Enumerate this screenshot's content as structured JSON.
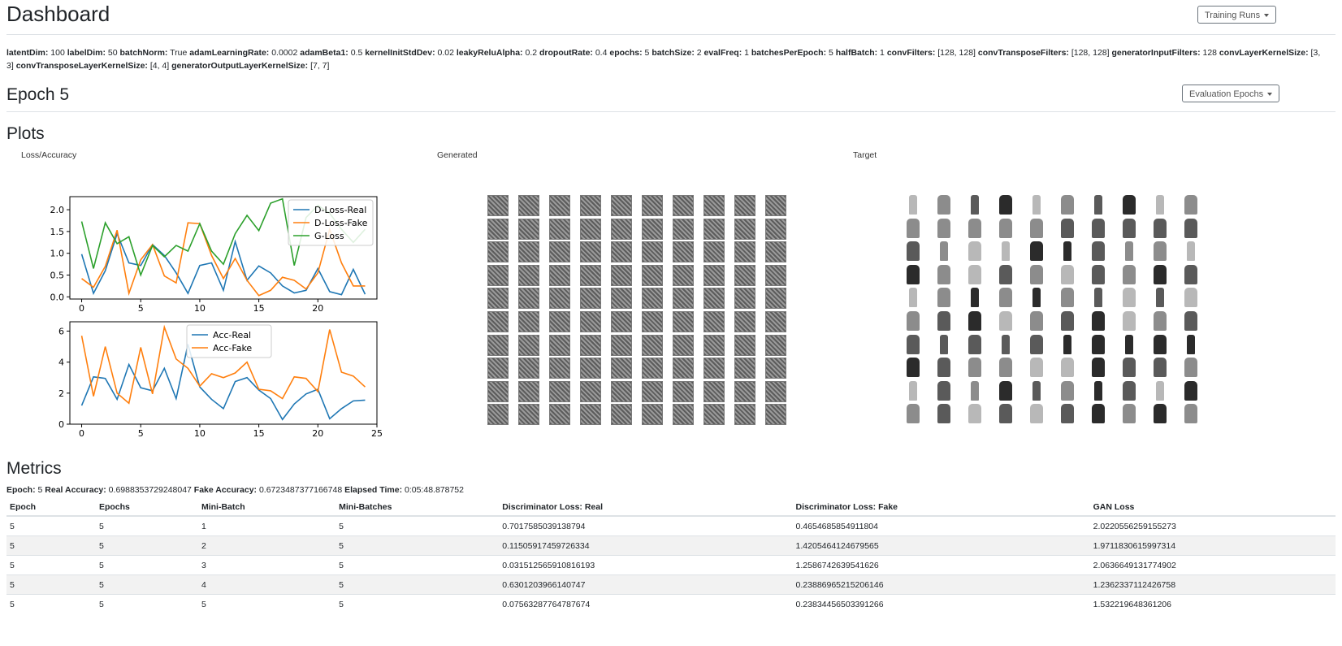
{
  "header": {
    "title": "Dashboard",
    "training_runs_label": "Training Runs"
  },
  "params": [
    {
      "key": "latentDim:",
      "value": "100"
    },
    {
      "key": "labelDim:",
      "value": "50"
    },
    {
      "key": "batchNorm:",
      "value": "True"
    },
    {
      "key": "adamLearningRate:",
      "value": "0.0002"
    },
    {
      "key": "adamBeta1:",
      "value": "0.5"
    },
    {
      "key": "kernelInitStdDev:",
      "value": "0.02"
    },
    {
      "key": "leakyReluAlpha:",
      "value": "0.2"
    },
    {
      "key": "dropoutRate:",
      "value": "0.4"
    },
    {
      "key": "epochs:",
      "value": "5"
    },
    {
      "key": "batchSize:",
      "value": "2"
    },
    {
      "key": "evalFreq:",
      "value": "1"
    },
    {
      "key": "batchesPerEpoch:",
      "value": "5"
    },
    {
      "key": "halfBatch:",
      "value": "1"
    },
    {
      "key": "convFilters:",
      "value": "[128, 128]"
    },
    {
      "key": "convTransposeFilters:",
      "value": "[128, 128]"
    },
    {
      "key": "generatorInputFilters:",
      "value": "128"
    },
    {
      "key": "convLayerKernelSize:",
      "value": "[3, 3]"
    },
    {
      "key": "convTransposeLayerKernelSize:",
      "value": "[4, 4]"
    },
    {
      "key": "generatorOutputLayerKernelSize:",
      "value": "[7, 7]"
    }
  ],
  "epoch_section": {
    "title": "Epoch 5",
    "evaluation_epochs_label": "Evaluation Epochs"
  },
  "plots": {
    "title": "Plots",
    "loss_label": "Loss/Accuracy",
    "generated_label": "Generated",
    "target_label": "Target",
    "generated_tile_color": "#7a7a7a",
    "target_tile_colors": [
      "#b8b8b8",
      "#2b2b2b",
      "#5a5a5a",
      "#8c8c8c"
    ]
  },
  "chart_data": [
    {
      "type": "line",
      "x": [
        0,
        1,
        2,
        3,
        4,
        5,
        6,
        7,
        8,
        9,
        10,
        11,
        12,
        13,
        14,
        15,
        16,
        17,
        18,
        19,
        20,
        21,
        22,
        23,
        24
      ],
      "xlim": [
        -1,
        25
      ],
      "ylim": [
        -0.05,
        2.3
      ],
      "xticks": [
        "0",
        "5",
        "10",
        "15",
        "20"
      ],
      "yticks": [
        "0.0",
        "0.5",
        "1.0",
        "1.5",
        "2.0"
      ],
      "legend_position": "top-right",
      "series": [
        {
          "name": "D-Loss-Real",
          "color": "#1f77b4",
          "values": [
            0.98,
            0.08,
            0.6,
            1.45,
            0.78,
            0.72,
            1.2,
            0.95,
            0.55,
            0.08,
            0.72,
            0.78,
            0.15,
            1.27,
            0.38,
            0.71,
            0.55,
            0.25,
            0.09,
            0.15,
            0.65,
            0.12,
            0.05,
            0.63,
            0.06
          ]
        },
        {
          "name": "D-Loss-Fake",
          "color": "#ff7f0e",
          "values": [
            0.42,
            0.22,
            0.7,
            1.53,
            0.08,
            0.85,
            1.2,
            0.48,
            0.32,
            1.7,
            1.68,
            0.95,
            0.42,
            0.88,
            0.38,
            0.03,
            0.15,
            0.45,
            0.38,
            0.18,
            0.55,
            1.55,
            0.78,
            0.25,
            0.25
          ]
        },
        {
          "name": "G-Loss",
          "color": "#2ca02c",
          "values": [
            1.73,
            0.65,
            1.7,
            1.22,
            1.38,
            0.5,
            1.18,
            0.92,
            1.18,
            1.05,
            1.68,
            1.05,
            0.75,
            1.45,
            1.87,
            1.52,
            2.15,
            2.25,
            0.72,
            1.82,
            2.1,
            1.92,
            1.55,
            1.25,
            1.55
          ]
        }
      ]
    },
    {
      "type": "line",
      "x": [
        0,
        1,
        2,
        3,
        4,
        5,
        6,
        7,
        8,
        9,
        10,
        11,
        12,
        13,
        14,
        15,
        16,
        17,
        18,
        19,
        20,
        21,
        22,
        23,
        24
      ],
      "xlim": [
        -1,
        25
      ],
      "ylim": [
        0,
        6.6
      ],
      "xticks": [
        "0",
        "5",
        "10",
        "15",
        "20",
        "25"
      ],
      "yticks": [
        "0",
        "2",
        "4",
        "6"
      ],
      "legend_position": "top-center",
      "series": [
        {
          "name": "Acc-Real",
          "color": "#1f77b4",
          "values": [
            1.2,
            3.05,
            2.95,
            1.6,
            3.85,
            2.35,
            2.15,
            3.6,
            1.65,
            5.15,
            2.4,
            1.6,
            1.0,
            2.75,
            3.0,
            2.2,
            1.65,
            0.3,
            1.3,
            1.95,
            2.25,
            0.35,
            1.0,
            1.5,
            1.55
          ]
        },
        {
          "name": "Acc-Fake",
          "color": "#ff7f0e",
          "values": [
            5.7,
            1.8,
            5.0,
            2.0,
            1.35,
            4.95,
            1.95,
            6.25,
            4.2,
            3.6,
            2.45,
            3.25,
            3.0,
            3.3,
            4.0,
            2.25,
            2.15,
            1.65,
            3.05,
            2.95,
            2.1,
            6.1,
            3.35,
            3.1,
            2.4
          ]
        }
      ]
    }
  ],
  "metrics": {
    "title": "Metrics",
    "summary": [
      {
        "key": "Epoch:",
        "value": "5"
      },
      {
        "key": "Real Accuracy:",
        "value": "0.6988353729248047"
      },
      {
        "key": "Fake Accuracy:",
        "value": "0.6723487377166748"
      },
      {
        "key": "Elapsed Time:",
        "value": "0:05:48.878752"
      }
    ],
    "columns": [
      "Epoch",
      "Epochs",
      "Mini-Batch",
      "Mini-Batches",
      "Discriminator Loss: Real",
      "Discriminator Loss: Fake",
      "GAN Loss"
    ],
    "rows": [
      [
        "5",
        "5",
        "1",
        "5",
        "0.7017585039138794",
        "0.4654685854911804",
        "2.0220556259155273"
      ],
      [
        "5",
        "5",
        "2",
        "5",
        "0.11505917459726334",
        "1.4205464124679565",
        "1.9711830615997314"
      ],
      [
        "5",
        "5",
        "3",
        "5",
        "0.031512565910816193",
        "1.2586742639541626",
        "2.0636649131774902"
      ],
      [
        "5",
        "5",
        "4",
        "5",
        "0.6301203966140747",
        "0.23886965215206146",
        "1.2362337112426758"
      ],
      [
        "5",
        "5",
        "5",
        "5",
        "0.07563287764787674",
        "0.23834456503391266",
        "1.532219648361206"
      ]
    ]
  }
}
